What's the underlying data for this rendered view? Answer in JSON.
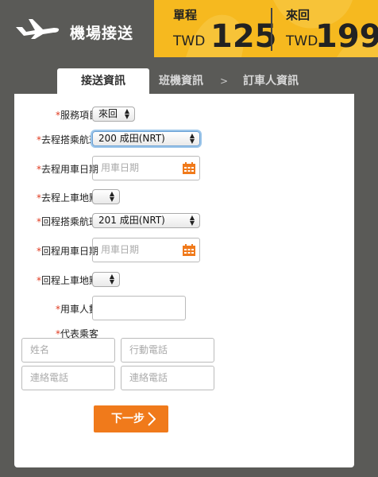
{
  "header": {
    "title": "機場接送",
    "one_way": {
      "label": "單程",
      "currency": "TWD",
      "price": "125"
    },
    "round_trip": {
      "label": "來回",
      "currency": "TWD",
      "price": "199"
    }
  },
  "tabs": {
    "active": "接送資訊",
    "second": "班機資訊",
    "separator": ">",
    "third": "訂車人資訊"
  },
  "form": {
    "service": {
      "label": "服務項目",
      "value": "來回"
    },
    "depart_flight": {
      "label": "去程搭乘航班",
      "value": "200 成田(NRT)"
    },
    "depart_date": {
      "label": "去程用車日期",
      "placeholder": "用車日期"
    },
    "depart_pickup": {
      "label": "去程上車地點",
      "value": ""
    },
    "return_flight": {
      "label": "回程搭乘航班",
      "value": "201 成田(NRT)"
    },
    "return_date": {
      "label": "回程用車日期",
      "placeholder": "用車日期"
    },
    "return_pickup": {
      "label": "回程上車地點",
      "value": ""
    },
    "passengers": {
      "label": "用車人數",
      "value": ""
    },
    "representative": {
      "label": "代表乘客",
      "name_placeholder": "姓名",
      "mobile_placeholder": "行動電話",
      "contact1_placeholder": "連絡電話",
      "contact2_placeholder": "連絡電話"
    },
    "required_mark": "*",
    "next_button": "下一步"
  },
  "colors": {
    "accent": "#f07a1b",
    "price_bg": "#f6b91f",
    "frame": "#5a5a57",
    "required": "#e03a1f"
  }
}
